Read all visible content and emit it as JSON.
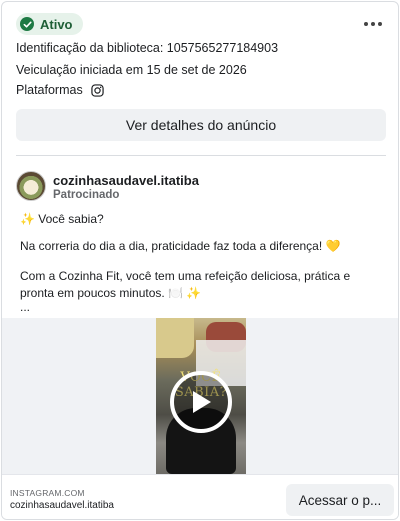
{
  "status": {
    "label": "Ativo",
    "color": "#1e7a44",
    "icon": "check-circle-icon"
  },
  "menu": {
    "icon": "more-horizontal-icon"
  },
  "ad_info": {
    "library_id": "Identificação da biblioteca: 1057565277184903",
    "start_date": "Veiculação iniciada em 15 de set de 2026",
    "platforms_label": "Plataformas",
    "platform_icon": "instagram-icon"
  },
  "details_button": {
    "label": "Ver detalhes do anúncio"
  },
  "advertiser": {
    "name": "cozinhasaudavel.itatiba",
    "sponsored": "Patrocinado"
  },
  "post": {
    "line1": "✨ Você sabia?",
    "line2": "Na correria do dia a dia, praticidade faz toda a diferença! 💛",
    "line3": "Com a Cozinha Fit, você tem uma refeição deliciosa, prática e pronta em poucos minutos. 🍽️ ✨",
    "line4": "..."
  },
  "media": {
    "overlay_text": "VOCÊ SABIA?",
    "icon": "play-icon"
  },
  "footer": {
    "domain": "INSTAGRAM.COM",
    "name": "cozinhasaudavel.itatiba",
    "cta_label": "Acessar o p..."
  }
}
